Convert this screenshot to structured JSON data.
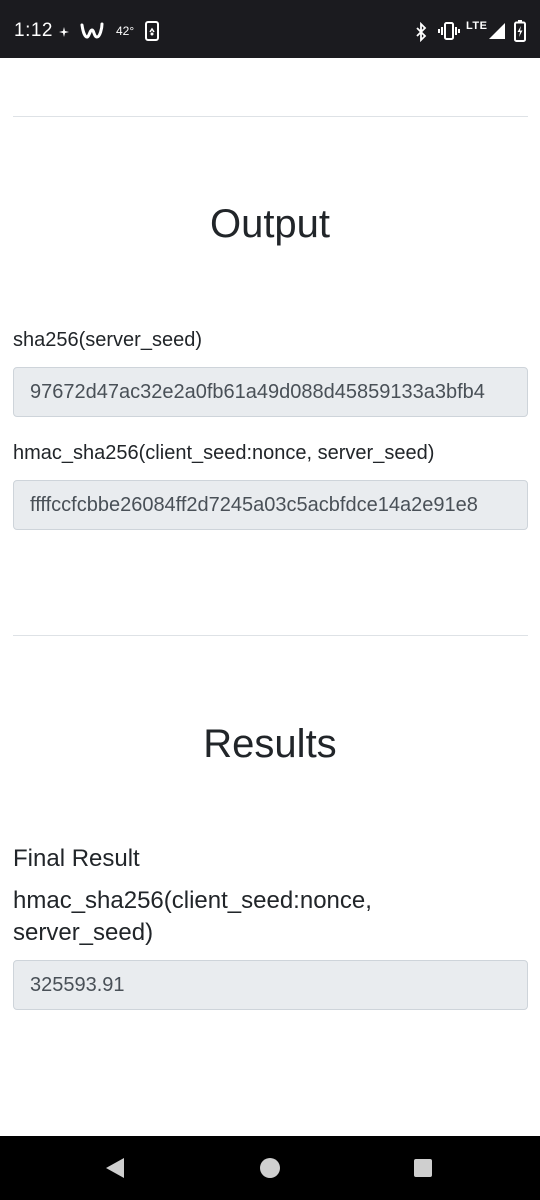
{
  "status_bar": {
    "time": "1:12",
    "temperature": "42°",
    "network": "LTE",
    "icons": [
      "pinwheel-icon",
      "wish-app-icon",
      "phone-screen-icon",
      "bluetooth-icon",
      "vibrate-icon",
      "signal-icon",
      "battery-charging-icon"
    ]
  },
  "output_section": {
    "heading": "Output",
    "fields": [
      {
        "label": "sha256(server_seed)",
        "value": "97672d47ac32e2a0fb61a49d088d45859133a3bfb4"
      },
      {
        "label": "hmac_sha256(client_seed:nonce, server_seed)",
        "value": "ffffccfcbbe26084ff2d7245a03c5acbfdce14a2e91e8"
      }
    ]
  },
  "results_section": {
    "heading": "Results",
    "final_result_title": "Final Result",
    "final_result_subtitle": "hmac_sha256(client_seed:nonce, server_seed)",
    "final_result_value": "325593.91"
  },
  "nav_bar": {
    "buttons": [
      "back-icon",
      "home-icon",
      "recents-icon"
    ]
  },
  "colors": {
    "status_bar_bg": "#1b1b1f",
    "input_bg": "#e9ecef",
    "input_border": "#ced4da",
    "divider": "#dee2e6",
    "text": "#212529"
  }
}
